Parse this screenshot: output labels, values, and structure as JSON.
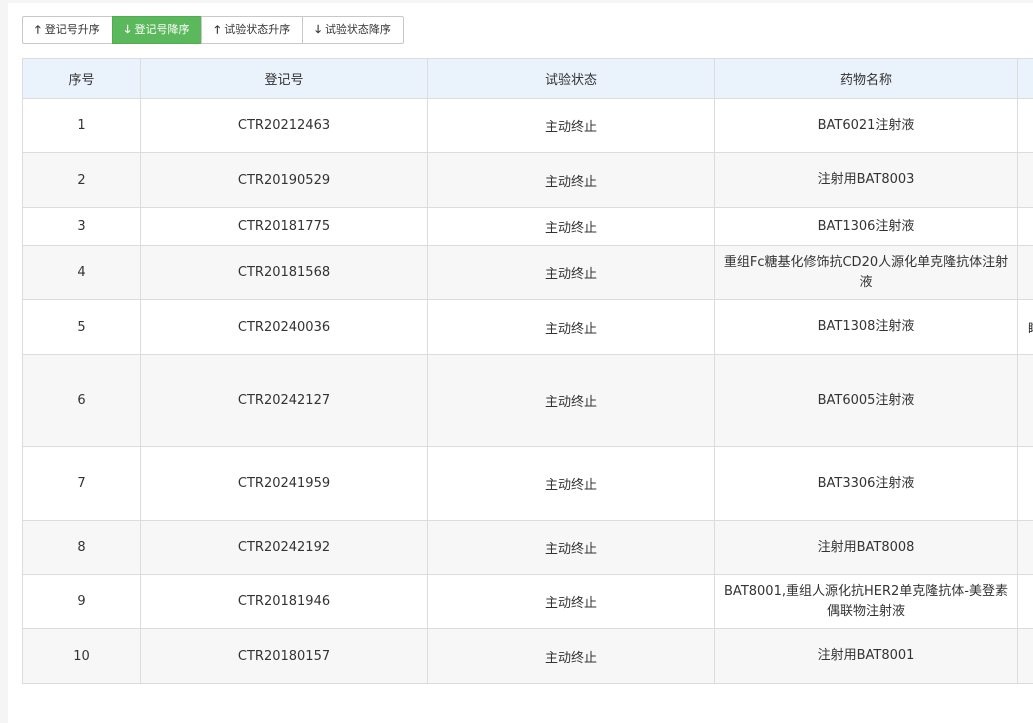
{
  "toolbar": {
    "buttons": [
      {
        "label": "登记号升序",
        "icon": "arrow-up-icon",
        "arrow": "🡑",
        "active": false
      },
      {
        "label": "登记号降序",
        "icon": "arrow-down-icon",
        "arrow": "🡓",
        "active": true
      },
      {
        "label": "试验状态升序",
        "icon": "arrow-up-icon",
        "arrow": "🡑",
        "active": false
      },
      {
        "label": "试验状态降序",
        "icon": "arrow-down-icon",
        "arrow": "🡓",
        "active": false
      }
    ],
    "active_color": "#5cb85c"
  },
  "table": {
    "headers": [
      "序号",
      "登记号",
      "试验状态",
      "药物名称",
      ""
    ],
    "rows": [
      {
        "no": "1",
        "reg": "CTR20212463",
        "status": "主动终止",
        "drug": "BAT6021注射液",
        "extra": ""
      },
      {
        "no": "2",
        "reg": "CTR20190529",
        "status": "主动终止",
        "drug": "注射用BAT8003",
        "extra": ""
      },
      {
        "no": "3",
        "reg": "CTR20181775",
        "status": "主动终止",
        "drug": "BAT1306注射液",
        "extra": ""
      },
      {
        "no": "4",
        "reg": "CTR20181568",
        "status": "主动终止",
        "drug": "重组Fc糖基化修饰抗CD20人源化单克隆抗体注射液",
        "extra": ""
      },
      {
        "no": "5",
        "reg": "CTR20240036",
        "status": "主动终止",
        "drug": "BAT1308注射液",
        "extra": "盽"
      },
      {
        "no": "6",
        "reg": "CTR20242127",
        "status": "主动终止",
        "drug": "BAT6005注射液",
        "extra": ""
      },
      {
        "no": "7",
        "reg": "CTR20241959",
        "status": "主动终止",
        "drug": "BAT3306注射液",
        "extra": ""
      },
      {
        "no": "8",
        "reg": "CTR20242192",
        "status": "主动终止",
        "drug": "注射用BAT8008",
        "extra": ""
      },
      {
        "no": "9",
        "reg": "CTR20181946",
        "status": "主动终止",
        "drug": "BAT8001,重组人源化抗HER2单克隆抗体-美登素偶联物注射液",
        "extra": ""
      },
      {
        "no": "10",
        "reg": "CTR20180157",
        "status": "主动终止",
        "drug": "注射用BAT8001",
        "extra": ""
      }
    ]
  }
}
